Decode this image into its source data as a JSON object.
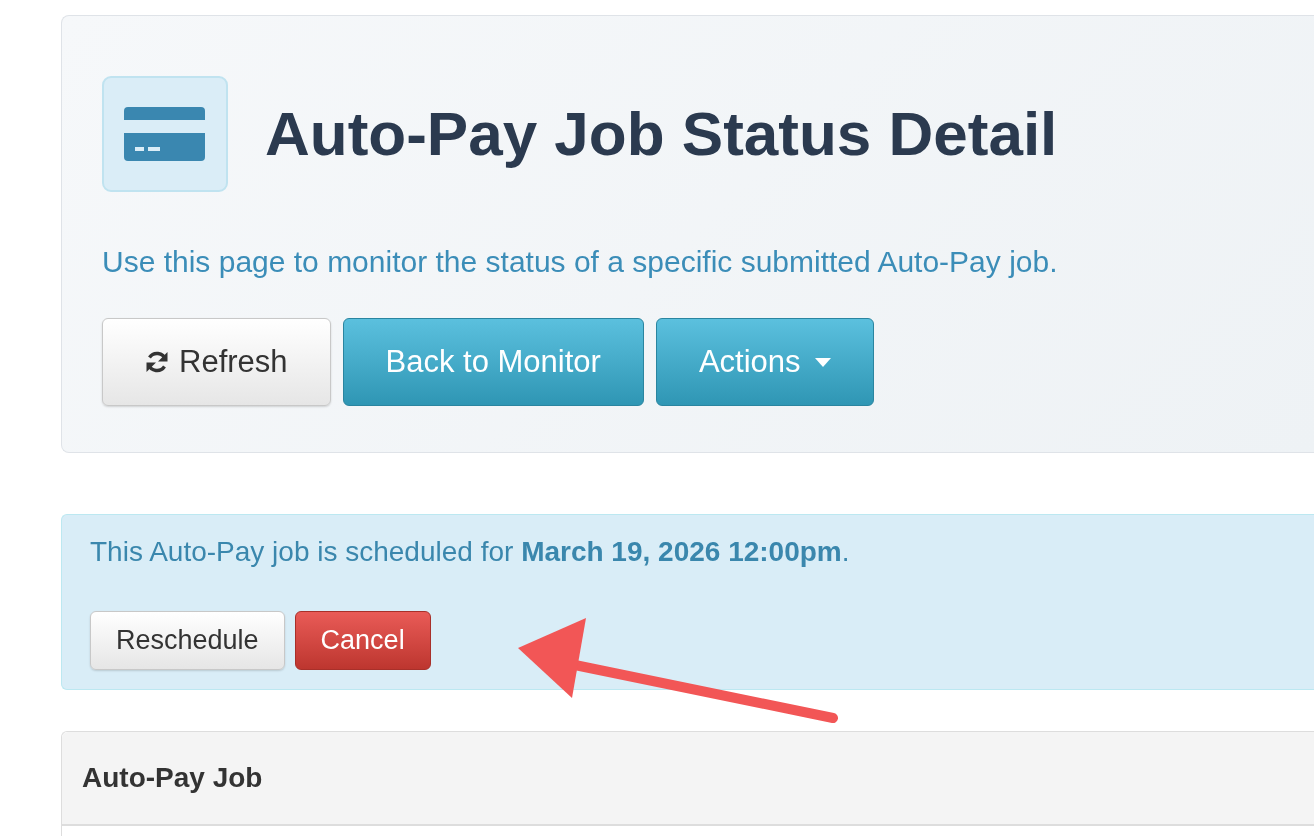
{
  "header": {
    "title": "Auto-Pay Job Status Detail",
    "description": "Use this page to monitor the status of a specific submitted Auto-Pay job.",
    "buttons": [
      {
        "label": "Refresh",
        "kind": "reload"
      },
      {
        "label": "Back to Monitor",
        "kind": "primary"
      },
      {
        "label": "Actions",
        "kind": "dropdown"
      }
    ]
  },
  "alert": {
    "message": "This Auto-Pay job is scheduled for **March 19, 2026 12:00pm**.",
    "buttons": [
      {
        "label": "Reschedule",
        "kind": "default"
      },
      {
        "label": "Cancel",
        "kind": "danger"
      }
    ]
  },
  "panel": {
    "title": "Auto-Pay Job"
  }
}
